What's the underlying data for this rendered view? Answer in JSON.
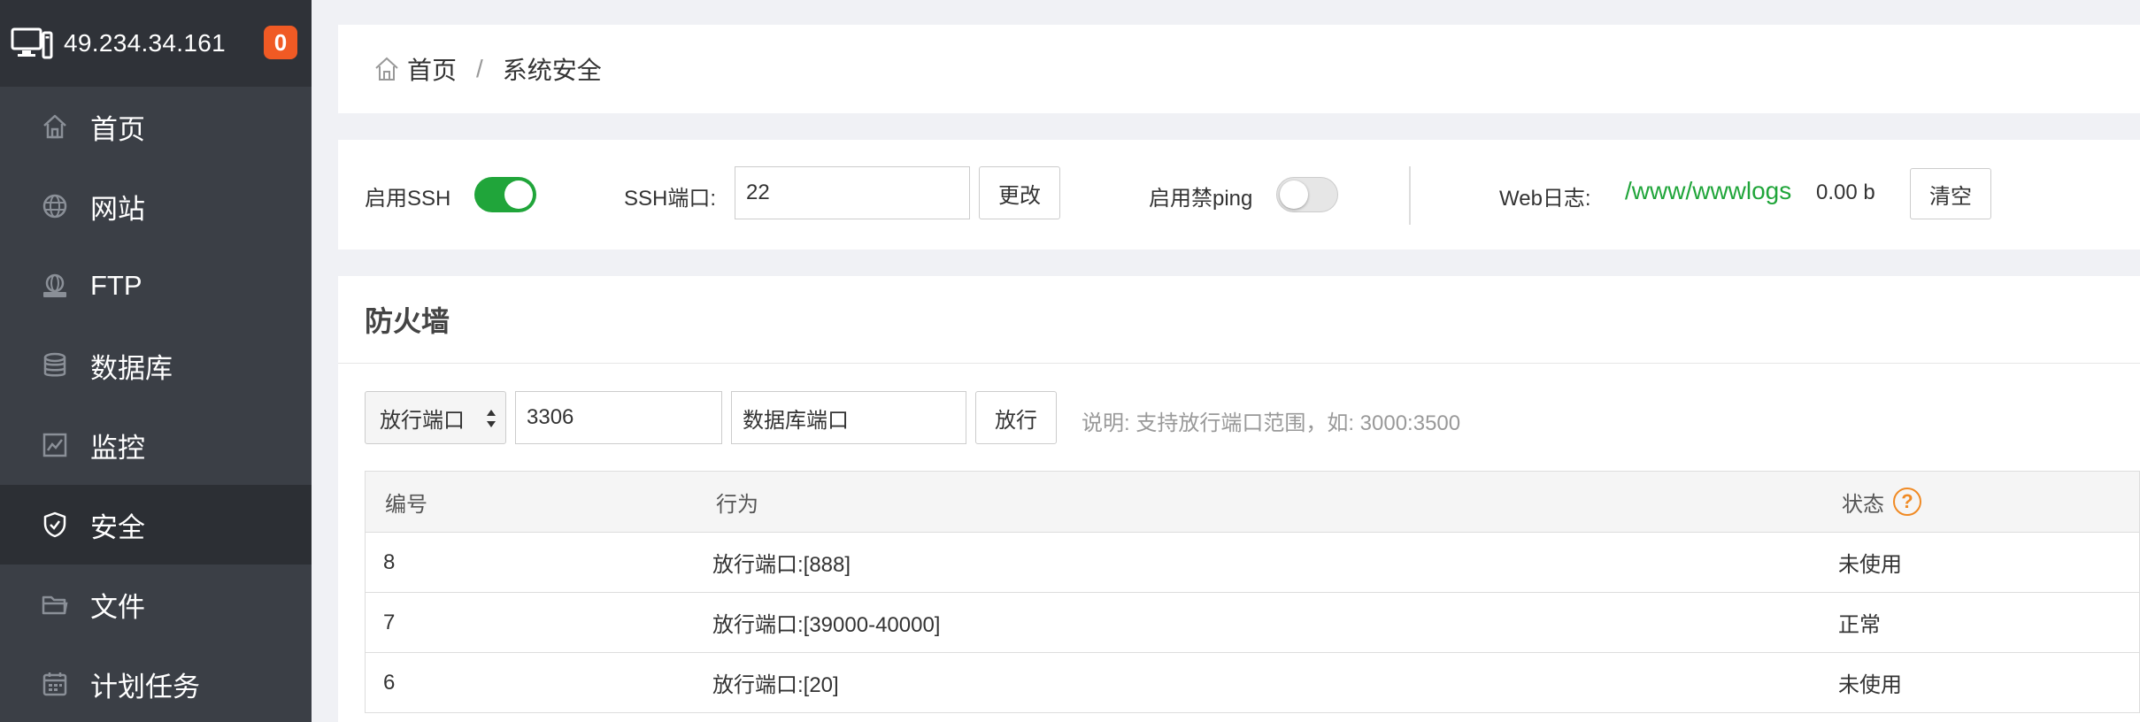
{
  "sidebar": {
    "server_ip": "49.234.34.161",
    "badge_count": "0",
    "items": [
      {
        "label": "首页",
        "icon": "home-icon",
        "active": false
      },
      {
        "label": "网站",
        "icon": "globe-icon",
        "active": false
      },
      {
        "label": "FTP",
        "icon": "ftp-icon",
        "active": false
      },
      {
        "label": "数据库",
        "icon": "database-icon",
        "active": false
      },
      {
        "label": "监控",
        "icon": "monitor-chart-icon",
        "active": false
      },
      {
        "label": "安全",
        "icon": "shield-icon",
        "active": true
      },
      {
        "label": "文件",
        "icon": "folder-icon",
        "active": false
      },
      {
        "label": "计划任务",
        "icon": "calendar-icon",
        "active": false
      }
    ]
  },
  "breadcrumb": {
    "home": "首页",
    "separator": "/",
    "current": "系统安全"
  },
  "settings": {
    "ssh_enable_label": "启用SSH",
    "ssh_enabled": true,
    "ssh_port_label": "SSH端口:",
    "ssh_port_value": "22",
    "change_button": "更改",
    "ping_ban_label": "启用禁ping",
    "ping_ban_enabled": false,
    "web_log_label": "Web日志:",
    "web_log_path": "/www/wwwlogs",
    "web_log_size": "0.00 b",
    "clear_button": "清空"
  },
  "firewall": {
    "title": "防火墙",
    "type_select": "放行端口",
    "port_value": "3306",
    "remark_value": "数据库端口",
    "allow_button": "放行",
    "hint": "说明: 支持放行端口范围，如: 3000:3500",
    "columns": {
      "id": "编号",
      "action": "行为",
      "status": "状态"
    },
    "help_icon_glyph": "?",
    "rows": [
      {
        "id": "8",
        "action": "放行端口:[888]",
        "status": "未使用"
      },
      {
        "id": "7",
        "action": "放行端口:[39000-40000]",
        "status": "正常"
      },
      {
        "id": "6",
        "action": "放行端口:[20]",
        "status": "未使用"
      }
    ]
  },
  "colors": {
    "accent_green": "#20a53a",
    "badge_orange": "#f05a24",
    "sidebar_bg": "#3b3f46",
    "sidebar_header_bg": "#2f3238",
    "sidebar_active_bg": "#2c2f34"
  }
}
